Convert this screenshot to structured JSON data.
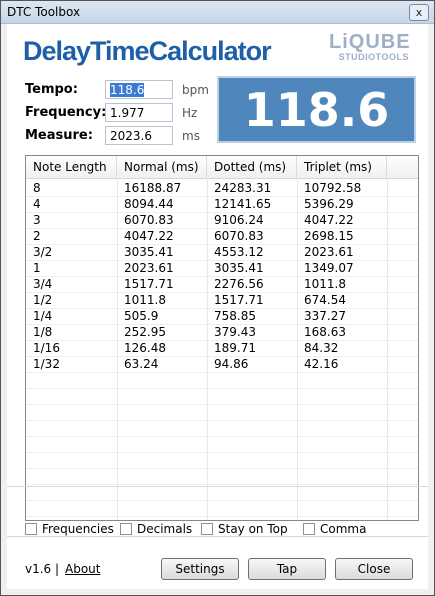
{
  "window": {
    "title": "DTC Toolbox",
    "close_glyph": "x"
  },
  "logo": {
    "main": "DelayTimeCalculator",
    "brand_line1": "LiQUBE",
    "brand_line2": "STUDIOTOOLS"
  },
  "fields": [
    {
      "label": "Tempo:",
      "value": "118.6",
      "unit": "bpm"
    },
    {
      "label": "Frequency:",
      "value": "1.977",
      "unit": "Hz"
    },
    {
      "label": "Measure:",
      "value": "2023.6",
      "unit": "ms"
    }
  ],
  "display": {
    "value": "118.6"
  },
  "table": {
    "columns": [
      "Note Length",
      "Normal (ms)",
      "Dotted (ms)",
      "Triplet (ms)"
    ],
    "rows": [
      [
        "8",
        "16188.87",
        "24283.31",
        "10792.58"
      ],
      [
        "4",
        "8094.44",
        "12141.65",
        "5396.29"
      ],
      [
        "3",
        "6070.83",
        "9106.24",
        "4047.22"
      ],
      [
        "2",
        "4047.22",
        "6070.83",
        "2698.15"
      ],
      [
        "3/2",
        "3035.41",
        "4553.12",
        "2023.61"
      ],
      [
        "1",
        "2023.61",
        "3035.41",
        "1349.07"
      ],
      [
        "3/4",
        "1517.71",
        "2276.56",
        "1011.8"
      ],
      [
        "1/2",
        "1011.8",
        "1517.71",
        "674.54"
      ],
      [
        "1/4",
        "505.9",
        "758.85",
        "337.27"
      ],
      [
        "1/8",
        "252.95",
        "379.43",
        "168.63"
      ],
      [
        "1/16",
        "126.48",
        "189.71",
        "84.32"
      ],
      [
        "1/32",
        "63.24",
        "94.86",
        "42.16"
      ]
    ]
  },
  "options": [
    {
      "label": "Frequencies",
      "checked": false
    },
    {
      "label": "Decimals",
      "checked": false
    },
    {
      "label": "Stay on Top",
      "checked": false
    },
    {
      "label": "Comma",
      "checked": false
    }
  ],
  "footer": {
    "version": "v1.6  |",
    "about": "About",
    "settings": "Settings",
    "tap": "Tap",
    "close": "Close"
  },
  "colors": {
    "display_bg": "#4f87bd",
    "logo_blue": "#1f5fa8",
    "brand_gray": "#9db0c6"
  }
}
